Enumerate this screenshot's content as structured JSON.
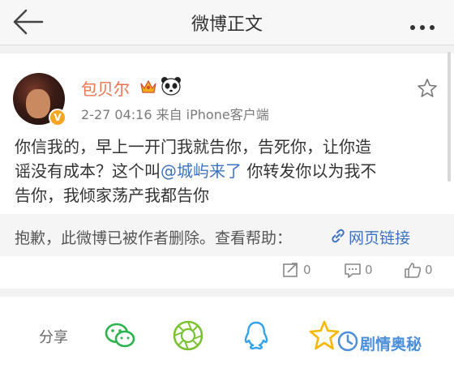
{
  "header": {
    "title": "微博正文"
  },
  "post": {
    "username": "包贝尔",
    "meta": "2-27 04:16  来自 iPhone客户端",
    "content_line1": "你信我的，早上一开门我就告你，告死你，让你造",
    "content_line2_a": "谣没有成本？这个叫",
    "mention": "@城屿来了",
    "content_line2_b": " 你转发你以为我不",
    "content_line3": "告你，我倾家荡产我都告你",
    "verified_mark": "V"
  },
  "deleted_notice": {
    "message": "抱歉，此微博已被作者删除。查看帮助：",
    "link_label": "网页链接"
  },
  "actions": {
    "repost_count": "0",
    "comment_count": "0",
    "like_count": "0"
  },
  "share": {
    "label": "分享",
    "icons": [
      "wechat-icon",
      "moments-icon",
      "qq-icon",
      "qzone-icon"
    ]
  },
  "watermark": {
    "text": "剧情奥秘"
  },
  "colors": {
    "username": "#eb7350",
    "link": "#3d73c2",
    "wechat": "#2bb24c",
    "qq": "#32a2e9",
    "qzone": "#f5b800"
  }
}
